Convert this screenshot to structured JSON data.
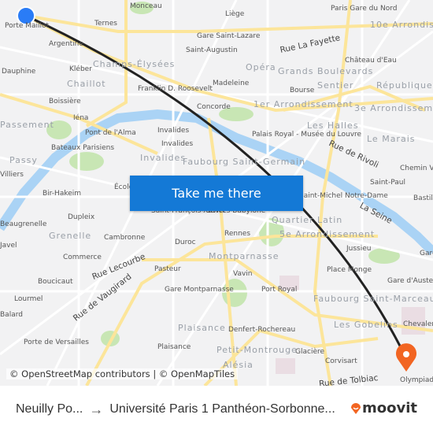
{
  "map": {
    "labels": [
      "Monceau",
      "Liège",
      "Paris Gare du Nord",
      "Porte Maillot",
      "Ternes",
      "Gare Saint-Lazare",
      "Argentine",
      "Saint-Augustin",
      "Château d'Eau",
      "Kléber",
      "Dauphine",
      "Madeleine",
      "Franklin D. Roosevelt",
      "Bourse",
      "Boissière",
      "Concorde",
      "Iéna",
      "Palais Royal - Musée du Louvre",
      "Pont de l'Alma",
      "Invalides",
      "Invalides",
      "Bateaux Parisiens",
      "Chemin Vert",
      "Saint-Paul",
      "Bastille",
      "Villiers",
      "Bir-Hakeim",
      "École",
      "Saint-Michel Notre-Dame",
      "Beaugrenelle",
      "Dupleix",
      "Saint-François-Xavier",
      "Sèvres-Babylone",
      "Cambronne",
      "Rennes",
      "Jussieu",
      "Duroc",
      "Commerce",
      "Place Monge",
      "Gare",
      "Pasteur",
      "Vavin",
      "Boucicaut",
      "Gare d'Austerlitz",
      "Gare Montparnasse",
      "Port Royal",
      "Lourmel",
      "Balard",
      "Denfert-Rochereau",
      "Chevaleret",
      "Porte de Versailles",
      "Plaisance",
      "Glacière",
      "Corvisart",
      "Olympiades",
      "Javel"
    ],
    "districts": [
      "Champs-Élysées",
      "Chaillot",
      "Opéra",
      "Sentier",
      "République",
      "Les Halles",
      "Le Marais",
      "Invalides",
      "Passy",
      "Grenelle",
      "Montparnasse",
      "Plaisance",
      "Petit-Montrouge",
      "Les Gobelins",
      "Alésia",
      "Quartier Latin",
      "Faubourg Saint-Germain",
      "Faubourg Saint-Marceau",
      "10e Arrondissement",
      "1er Arrondissement",
      "3e Arrondissement",
      "5e Arrondissement",
      "Grands Boulevards",
      "Passement"
    ],
    "roads": [
      "Rue La Fayette",
      "Rue de Rivoli",
      "La Seine",
      "Rue Lecourbe",
      "Rue de Vaugirard",
      "Rue de Tolbiac"
    ],
    "route_color": "#222222",
    "origin_color": "#2a7cf6",
    "destination_color": "#f26522",
    "water_color": "#aad3f5",
    "park_color": "#c8e6b4",
    "major_road_color": "#fce59a"
  },
  "cta": {
    "label": "Take me there"
  },
  "attribution": "© OpenStreetMap contributors | © OpenMapTiles",
  "footer": {
    "origin": "Neuilly Po...",
    "destination": "Université Paris 1 Panthéon-Sorbonne...",
    "brand": "moovit",
    "arrow_icon": "arrow-right-icon"
  }
}
